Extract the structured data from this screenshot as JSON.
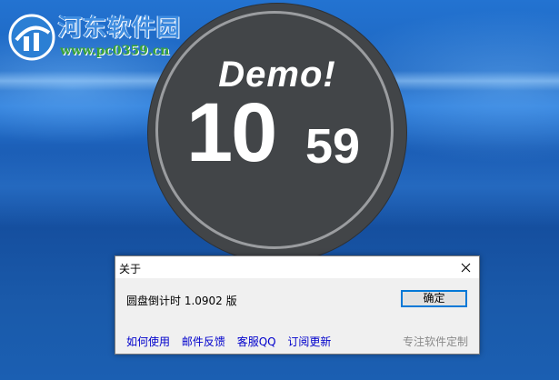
{
  "watermark": {
    "site_name": "河东软件园",
    "url": "www.pc0359.cn"
  },
  "timer": {
    "demo_label": "Demo!",
    "minutes": "10",
    "seconds": "59",
    "background_color": "#424548"
  },
  "dialog": {
    "title": "关于",
    "version_text": "圆盘倒计时 1.0902 版",
    "ok_label": "确定",
    "links": [
      "如何使用",
      "邮件反馈",
      "客服QQ",
      "订阅更新"
    ],
    "slogan": "专注软件定制",
    "link_color": "#0000cc"
  }
}
